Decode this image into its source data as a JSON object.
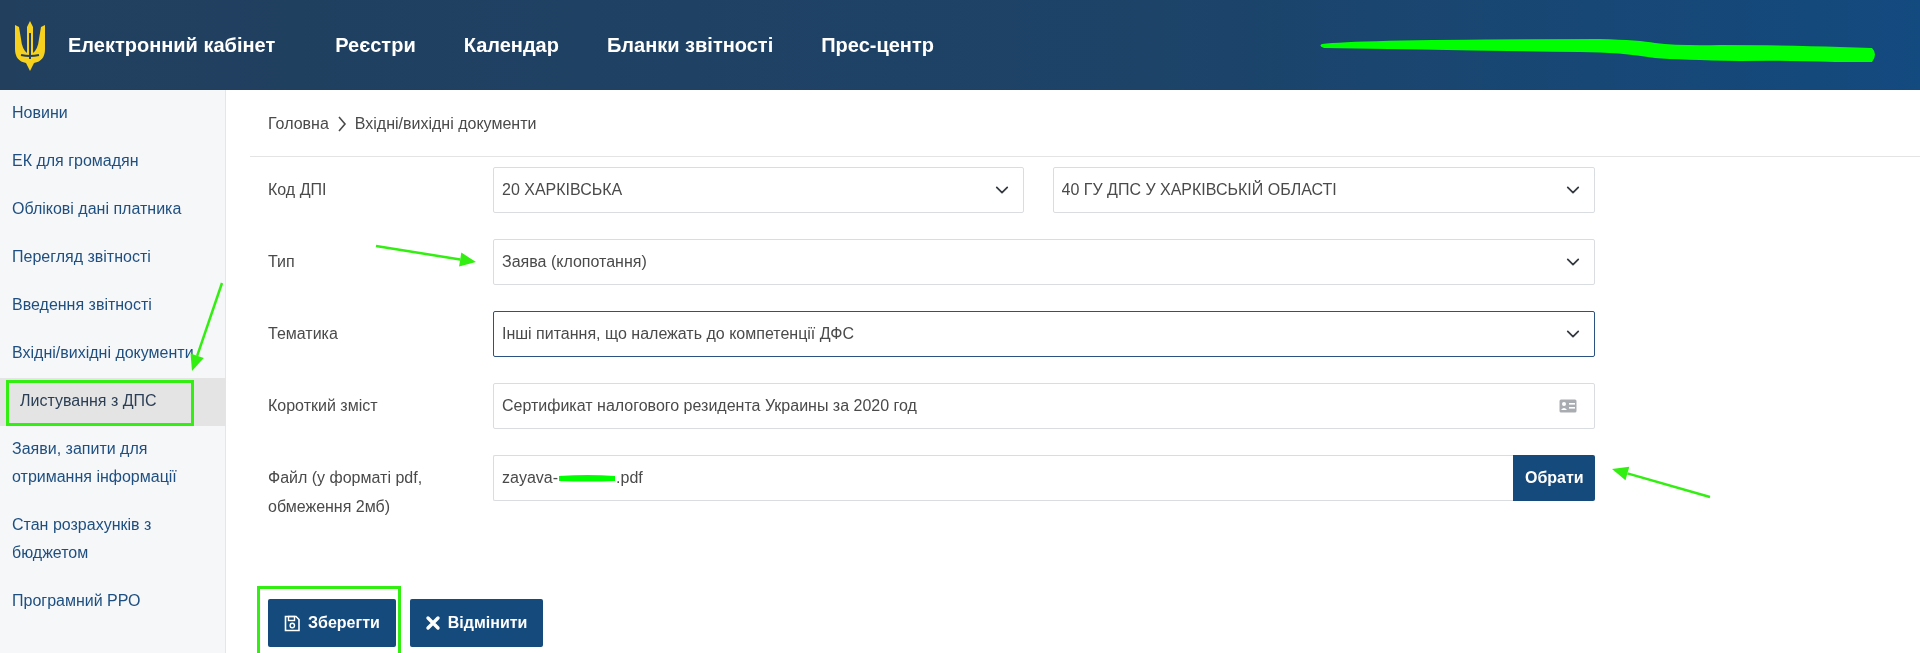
{
  "header": {
    "brand": "Електронний кабінет",
    "nav": [
      {
        "label": "Реєстри"
      },
      {
        "label": "Календар"
      },
      {
        "label": "Бланки звітності"
      },
      {
        "label": "Прес-центр"
      }
    ],
    "user_redacted": true
  },
  "sidebar": {
    "arrow": true,
    "items": [
      {
        "label": "Новини",
        "selected": false,
        "highlighted": false
      },
      {
        "label": "ЕК для громадян",
        "selected": false,
        "highlighted": false
      },
      {
        "label": "Облікові дані платника",
        "selected": false,
        "highlighted": false
      },
      {
        "label": "Перегляд звітності",
        "selected": false,
        "highlighted": false
      },
      {
        "label": "Введення звітності",
        "selected": false,
        "highlighted": false
      },
      {
        "label": "Вхідні/вихідні документи",
        "selected": false,
        "highlighted": false
      },
      {
        "label": "Листування з ДПС",
        "selected": true,
        "highlighted": true
      },
      {
        "label": "Заяви, запити для отримання інформації",
        "selected": false,
        "highlighted": false
      },
      {
        "label": "Стан розрахунків з бюджетом",
        "selected": false,
        "highlighted": false
      },
      {
        "label": "Програмний РРО",
        "selected": false,
        "highlighted": false
      }
    ]
  },
  "breadcrumb": [
    "Головна",
    "Вхідні/вихідні документи"
  ],
  "form": {
    "rows": [
      {
        "kind": "select-pair",
        "label": "Код ДПІ",
        "values": [
          "20 ХАРКІВСЬКА",
          "40 ГУ ДПС У ХАРКІВСЬКІЙ ОБЛАСТІ"
        ],
        "focused": false,
        "arrow": false
      },
      {
        "kind": "select",
        "label": "Тип",
        "value": "Заява (клопотання)",
        "focused": false,
        "arrow": true
      },
      {
        "kind": "select",
        "label": "Тематика",
        "value": "Інші питання, що належать до компетенції ДФС",
        "focused": true,
        "arrow": false
      },
      {
        "kind": "text",
        "label": "Короткий зміст",
        "value": "Сертификат налогового резидента Украины за 2020 год",
        "arrow": false
      },
      {
        "kind": "file",
        "label": "Файл (у форматі pdf, обмеження 2мб)",
        "value_start": "zayava-",
        "value_end": ".pdf",
        "button": "Обрати",
        "arrow": true
      }
    ]
  },
  "actions": [
    {
      "kind": "save",
      "label": "Зберегти",
      "highlighted": true
    },
    {
      "kind": "cancel",
      "label": "Відмінити",
      "highlighted": false
    }
  ]
}
